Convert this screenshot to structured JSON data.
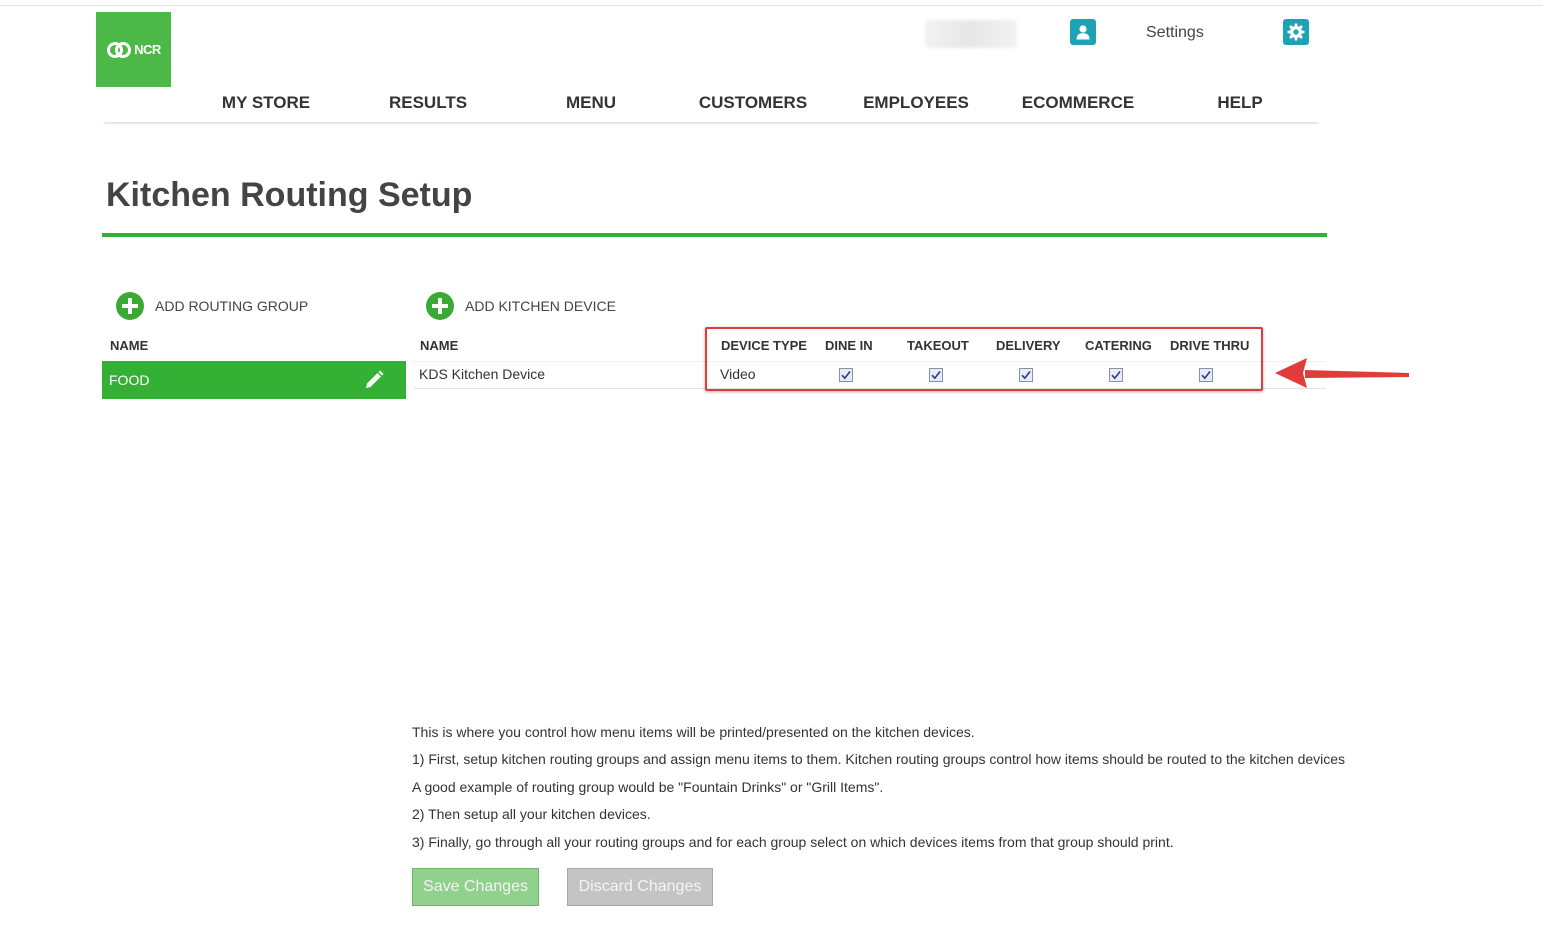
{
  "header": {
    "logo_text": "NCR",
    "settings_label": "Settings"
  },
  "nav": {
    "items": [
      "MY STORE",
      "RESULTS",
      "MENU",
      "CUSTOMERS",
      "EMPLOYEES",
      "ECOMMERCE",
      "HELP"
    ]
  },
  "page": {
    "title": "Kitchen Routing Setup"
  },
  "routing_groups": {
    "add_label": "ADD ROUTING GROUP",
    "name_header": "NAME",
    "items": [
      {
        "name": "FOOD"
      }
    ]
  },
  "kitchen_devices": {
    "add_label": "ADD KITCHEN DEVICE",
    "headers": {
      "name": "NAME",
      "device_type": "DEVICE TYPE",
      "dine_in": "DINE IN",
      "takeout": "TAKEOUT",
      "delivery": "DELIVERY",
      "catering": "CATERING",
      "drive_thru": "DRIVE THRU"
    },
    "rows": [
      {
        "name": "KDS Kitchen Device",
        "device_type": "Video",
        "dine_in": true,
        "takeout": true,
        "delivery": true,
        "catering": true,
        "drive_thru": true
      }
    ]
  },
  "help": {
    "lines": [
      "This is where you control how menu items will be printed/presented on the kitchen devices.",
      "1) First, setup kitchen routing groups and assign menu items to them. Kitchen routing groups control how items should be routed to the kitchen devices",
      "A good example of routing group would be \"Fountain Drinks\" or \"Grill Items\".",
      "2) Then setup all your kitchen devices.",
      "3) Finally, go through all your routing groups and for each group select on which devices items from that group should print."
    ]
  },
  "buttons": {
    "save": "Save Changes",
    "discard": "Discard Changes"
  },
  "colors": {
    "brand_green": "#4cb848",
    "accent_green": "#34b034",
    "teal": "#1ea3b6",
    "highlight_red": "#e03c3c"
  }
}
